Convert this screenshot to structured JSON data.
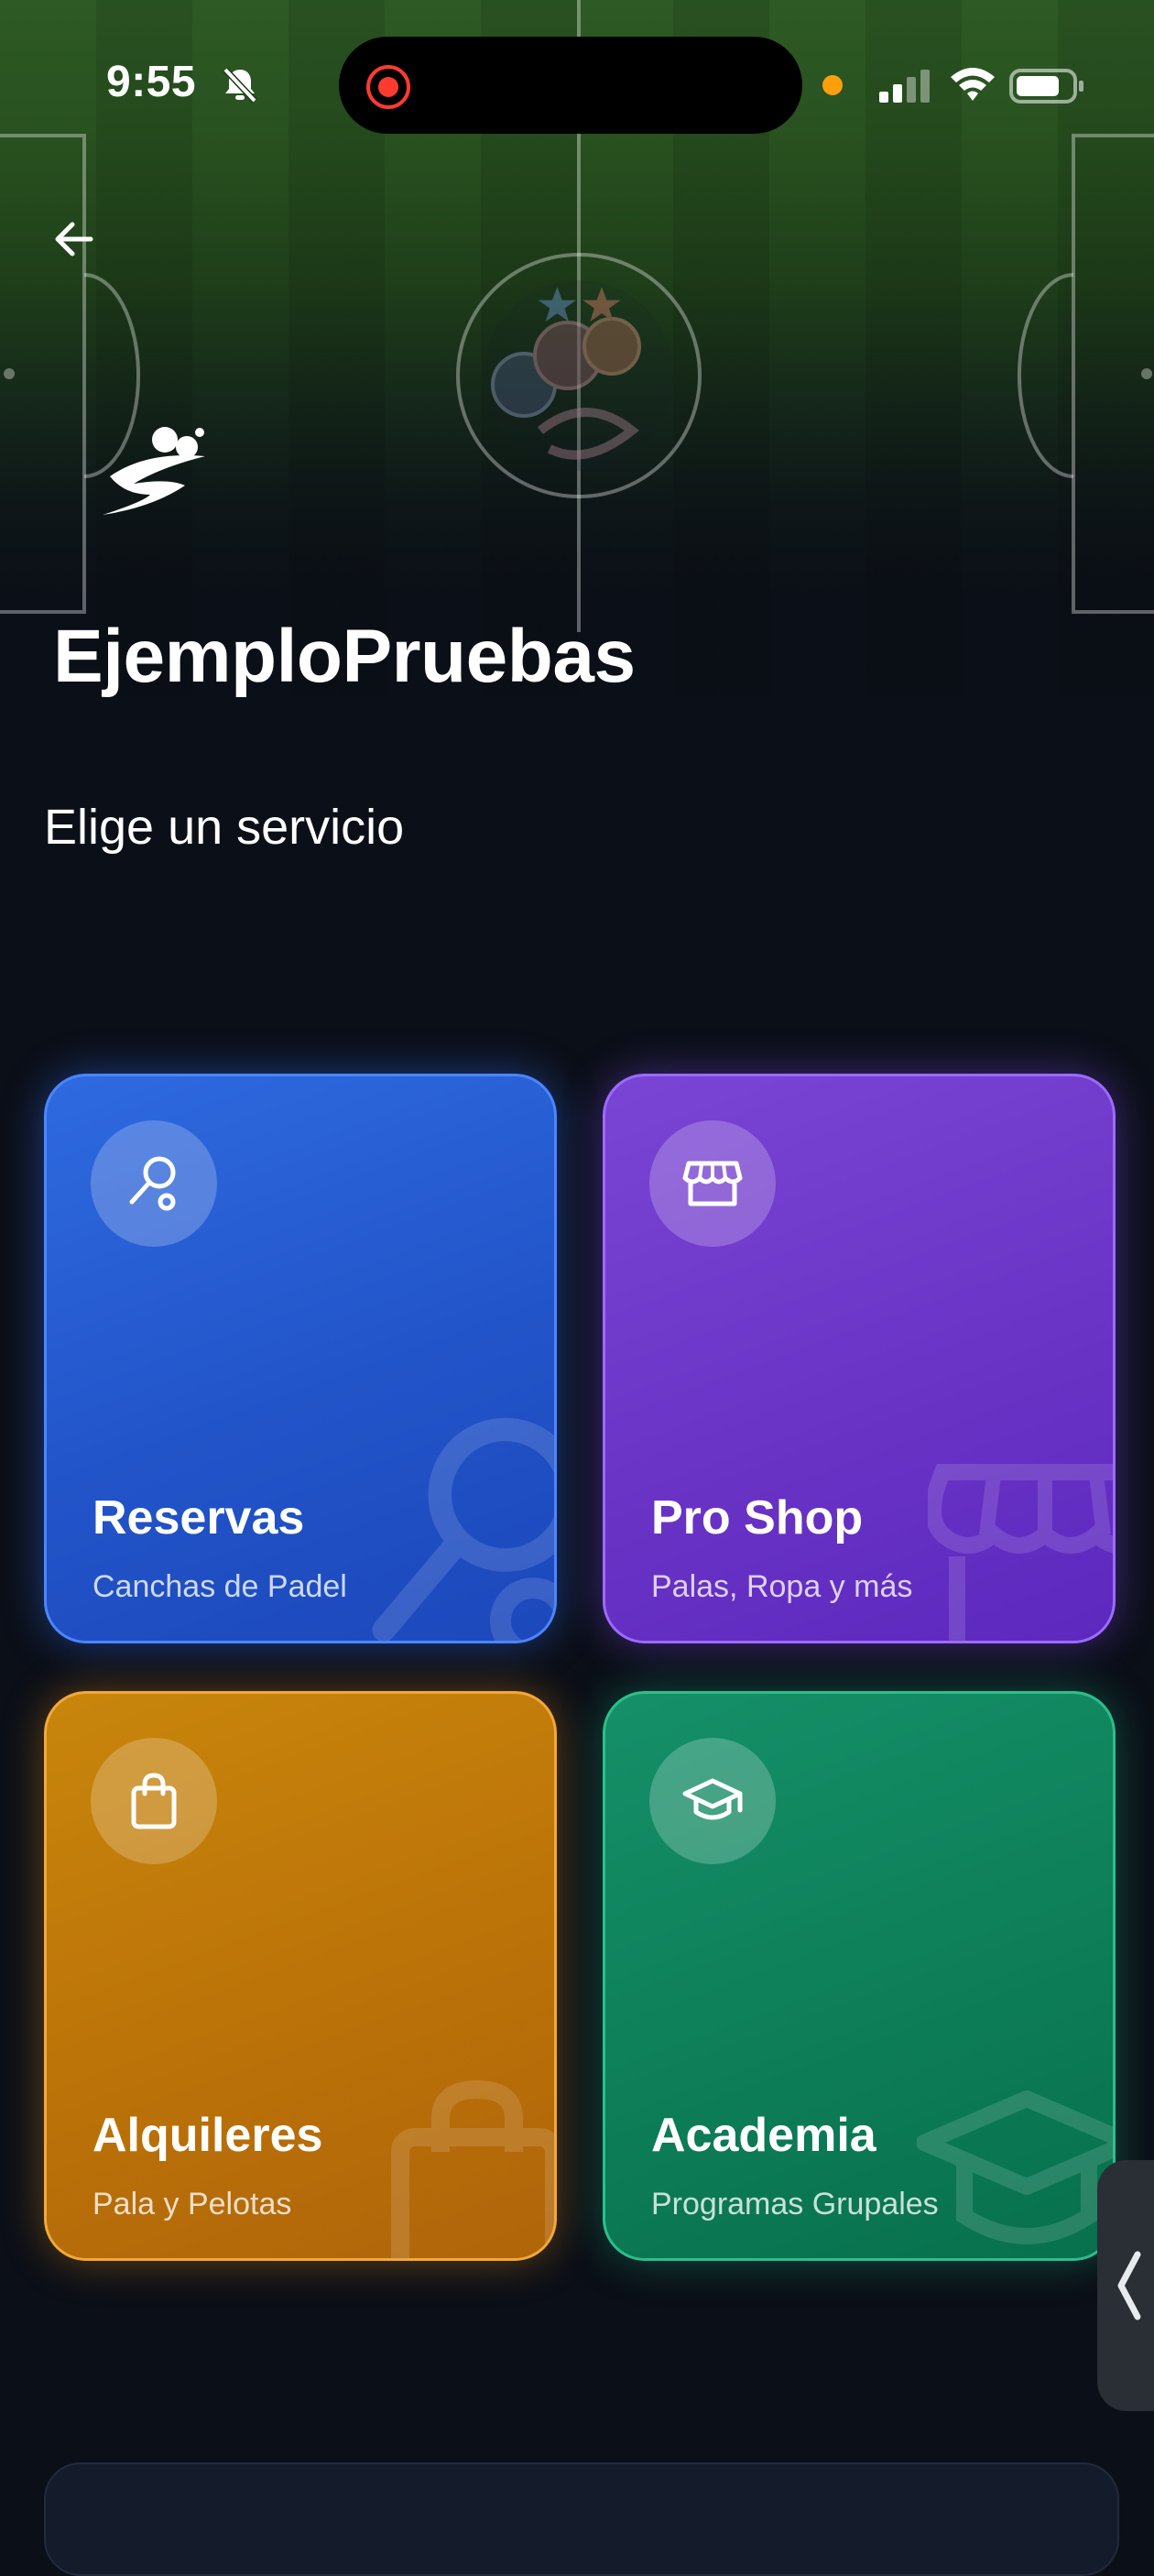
{
  "status_bar": {
    "time": "9:55"
  },
  "header": {
    "club_name": "EjemploPruebas",
    "section_title": "Elige un servicio"
  },
  "services": [
    {
      "title": "Reservas",
      "subtitle": "Canchas de Padel",
      "icon": "padel-racket-icon",
      "color": "#2456d0"
    },
    {
      "title": "Pro Shop",
      "subtitle": "Palas, Ropa y más",
      "icon": "store-icon",
      "color": "#6a34c6"
    },
    {
      "title": "Alquileres",
      "subtitle": "Pala y Pelotas",
      "icon": "shopping-bag-icon",
      "color": "#bb7208"
    },
    {
      "title": "Academia",
      "subtitle": "Programas Grupales",
      "icon": "graduation-cap-icon",
      "color": "#0d7e58"
    }
  ]
}
